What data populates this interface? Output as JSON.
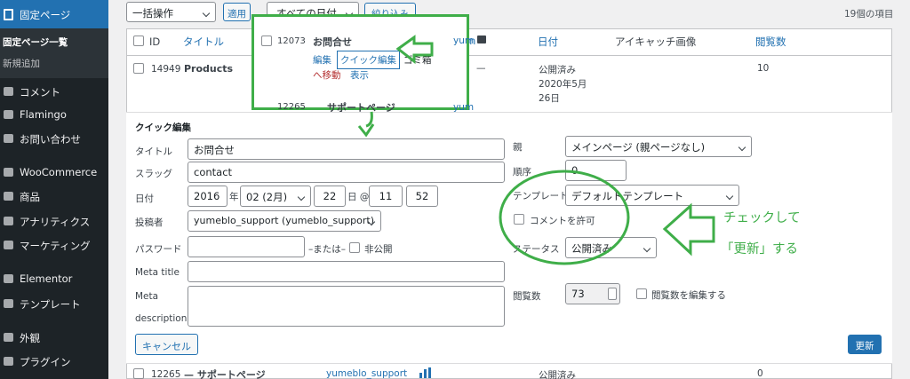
{
  "sidebar": {
    "current": "固定ページ",
    "sub_current": "固定ページ一覧",
    "sub_new": "新規追加",
    "items": [
      "コメント",
      "Flamingo",
      "お問い合わせ",
      "WooCommerce",
      "商品",
      "アナリティクス",
      "マーケティング",
      "Elementor",
      "テンプレート",
      "外観",
      "プラグイン"
    ]
  },
  "toolbar": {
    "bulk": "一括操作",
    "apply": "適用",
    "dates": "すべての日付",
    "filter": "絞り込み",
    "count": "19個の項目"
  },
  "table": {
    "headers": {
      "id": "ID",
      "title": "タイトル",
      "author": "yum",
      "date": "日付",
      "eyecatch": "アイキャッチ画像",
      "views": "閲覧数"
    },
    "rows": [
      {
        "id": "14949",
        "title": "Products",
        "author": "—",
        "status": "公開済み",
        "date": "2020年5月26日",
        "views": "10"
      },
      {
        "id": "12265",
        "title": "— サポートページ",
        "author": "yumeblo_support",
        "status": "公開済み",
        "views": "0"
      }
    ]
  },
  "popup": {
    "id": "12073",
    "title": "お問合せ",
    "edit": "編集",
    "quick": "クイック編集",
    "trash1": "ゴミ箱",
    "trash2": "へ移動",
    "view": "表示",
    "next_id": "12265",
    "next_title": "サポートページ",
    "next_author": "yum"
  },
  "quick_edit": {
    "heading": "クイック編集",
    "title_label": "タイトル",
    "title_value": "お問合せ",
    "slug_label": "スラッグ",
    "slug_value": "contact",
    "date_label": "日付",
    "year": "2016",
    "year_unit": "年",
    "month": "02 (2月)",
    "day": "22",
    "day_unit": "日 @",
    "hour": "11",
    "colon": ":",
    "minute": "52",
    "author_label": "投稿者",
    "author_value": "yumeblo_support (yumeblo_support)",
    "password_label": "パスワード",
    "or_label": "–または–",
    "private_label": "非公開",
    "meta_title_label": "Meta title",
    "meta_desc_label1": "Meta",
    "meta_desc_label2": "description",
    "parent_label": "親",
    "parent_value": "メインページ (親ページなし)",
    "order_label": "順序",
    "order_value": "0",
    "template_label": "テンプレート",
    "template_value": "デフォルトテンプレート",
    "comment_label": "コメントを許可",
    "status_label": "ステータス",
    "status_value": "公開済み",
    "views_label": "閲覧数",
    "views_value": "73",
    "views_edit_label": "閲覧数を編集する",
    "cancel": "キャンセル",
    "update": "更新"
  },
  "annotation": {
    "line1": "チェックして",
    "line2": "「更新」する",
    "color": "#3fae49"
  }
}
